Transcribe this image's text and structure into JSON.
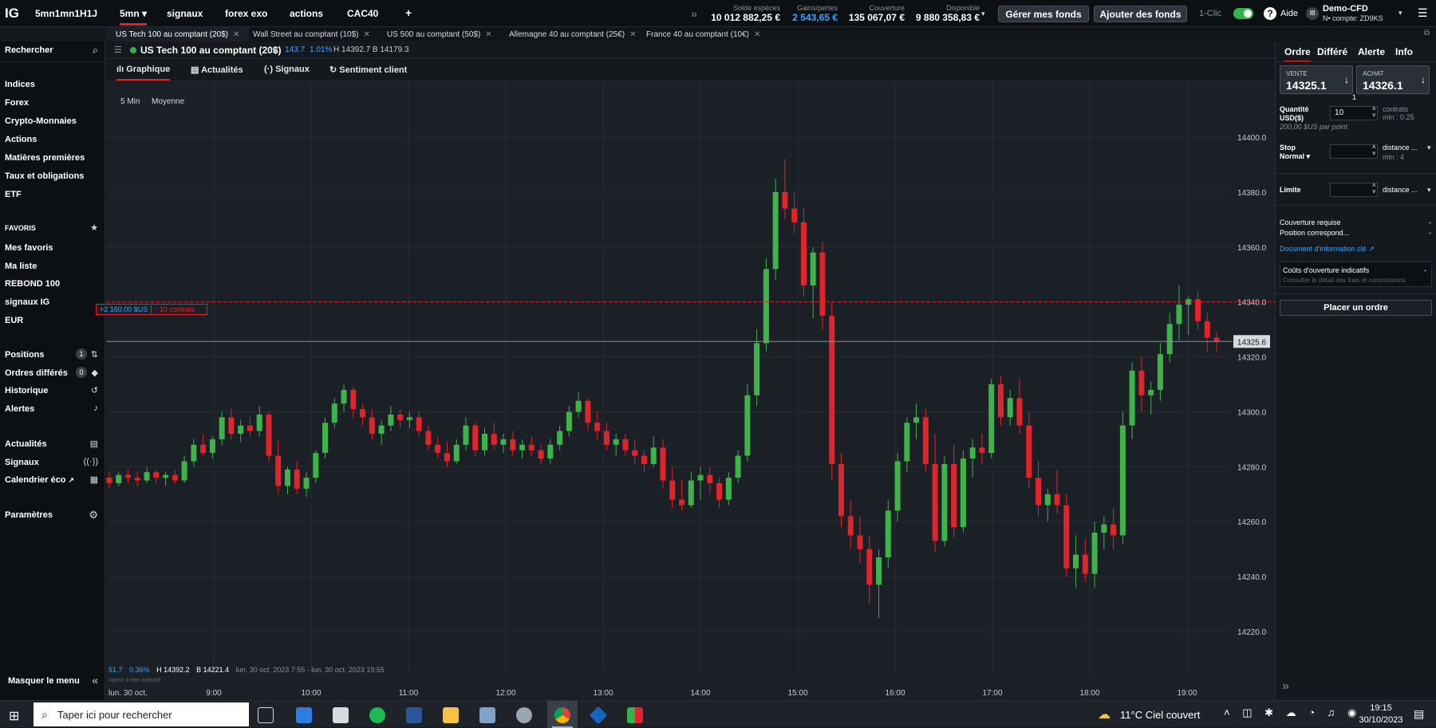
{
  "topbar": {
    "logo": "IG",
    "nav": [
      "5mn1mn1H1J",
      "5mn",
      "signaux",
      "forex exo",
      "actions",
      "CAC40",
      "+"
    ],
    "stats": [
      {
        "label": "Solde espèces",
        "value": "10 012 882,25 €"
      },
      {
        "label": "Gains/pertes",
        "value": "2 543,65 €"
      },
      {
        "label": "Couverture",
        "value": "135 067,07 €"
      },
      {
        "label": "Disponible",
        "value": "9 880 358,83 €"
      }
    ],
    "btn_manage": "Gérer mes fonds",
    "btn_add": "Ajouter des fonds",
    "oneclick": "1-Clic",
    "help": "Aide",
    "account_name": "Demo-CFD",
    "account_id": "N• compte: ZD9KS",
    "avatar": "IB",
    "accent": "#e0242b",
    "gain_color": "#3ba4ff"
  },
  "market_tabs": [
    "US Tech 100 au comptant (20$)",
    "Wall Street au comptant (10$)",
    "US 500 au comptant (50$)",
    "Allemagne 40 au comptant (25€)",
    "France 40 au comptant (10€)"
  ],
  "sidebar": {
    "search": "Rechercher",
    "markets": [
      "Indices",
      "Forex",
      "Crypto-Monnaies",
      "Actions",
      "Matières premières",
      "Taux et obligations",
      "ETF"
    ],
    "favorites_header": "FAVORIS",
    "favorites": [
      "Mes favoris",
      "Ma liste",
      "REBOND 100",
      "signaux IG",
      "EUR"
    ],
    "positions": "Positions",
    "positions_count": "1",
    "orders": "Ordres différés",
    "orders_count": "0",
    "history": "Historique",
    "alerts": "Alertes",
    "news": "Actualités",
    "signals": "Signaux",
    "calendar": "Calendrier éco",
    "settings": "Paramètres",
    "hide_menu": "Masquer le menu"
  },
  "chart_header": {
    "instrument": "US Tech 100 au comptant (20$)",
    "change": "143.7",
    "change_pct": "1.01%",
    "high_low": "H 14392.7  B 14179.3",
    "tabs": [
      "Graphique",
      "Actualités",
      "Signaux",
      "Sentiment client"
    ]
  },
  "chart_controls": {
    "interval": "5 Min",
    "type": "Moyenne"
  },
  "chart_footer": {
    "change": "51.7",
    "change_pct": "0.36%",
    "hl": "H 14392.2",
    "low": "B 14221.4",
    "range": "lun. 30 oct. 2023 7:55 - lun. 30 oct. 2023 19:55",
    "disclaimer": "Valeur à titre indicatif",
    "date_label": "lun. 30 oct."
  },
  "position_marker": {
    "pnl": "+2 160,00 $US",
    "size": "- 10 contrats",
    "price": 14340
  },
  "chart_data": {
    "type": "candlestick",
    "ylim": [
      14210,
      14410
    ],
    "yticks": [
      14220.0,
      14240.0,
      14260.0,
      14280.0,
      14300.0,
      14320.0,
      14340.0,
      14360.0,
      14380.0,
      14400.0
    ],
    "xticks": [
      "9:00",
      "10:00",
      "11:00",
      "12:00",
      "13:00",
      "14:00",
      "15:00",
      "16:00",
      "17:00",
      "18:00",
      "19:00"
    ],
    "last_price": 14325.6,
    "candles": [
      [
        14276,
        14278,
        14272,
        14274
      ],
      [
        14274,
        14278,
        14273,
        14277
      ],
      [
        14277,
        14279,
        14274,
        14276
      ],
      [
        14276,
        14278,
        14273,
        14275
      ],
      [
        14275,
        14280,
        14274,
        14278
      ],
      [
        14278,
        14279,
        14274,
        14276
      ],
      [
        14276,
        14278,
        14273,
        14277
      ],
      [
        14277,
        14279,
        14274,
        14275
      ],
      [
        14275,
        14284,
        14274,
        14282
      ],
      [
        14282,
        14290,
        14280,
        14288
      ],
      [
        14288,
        14292,
        14284,
        14285
      ],
      [
        14285,
        14291,
        14283,
        14290
      ],
      [
        14290,
        14300,
        14288,
        14298
      ],
      [
        14298,
        14301,
        14290,
        14292
      ],
      [
        14292,
        14297,
        14289,
        14295
      ],
      [
        14295,
        14298,
        14291,
        14293
      ],
      [
        14293,
        14302,
        14291,
        14299
      ],
      [
        14299,
        14300,
        14282,
        14284
      ],
      [
        14284,
        14290,
        14270,
        14273
      ],
      [
        14273,
        14280,
        14270,
        14279
      ],
      [
        14279,
        14282,
        14270,
        14272
      ],
      [
        14272,
        14278,
        14269,
        14276
      ],
      [
        14276,
        14286,
        14274,
        14285
      ],
      [
        14285,
        14298,
        14283,
        14296
      ],
      [
        14296,
        14305,
        14294,
        14303
      ],
      [
        14303,
        14310,
        14300,
        14308
      ],
      [
        14308,
        14309,
        14298,
        14301
      ],
      [
        14301,
        14303,
        14295,
        14298
      ],
      [
        14298,
        14301,
        14290,
        14292
      ],
      [
        14292,
        14297,
        14288,
        14295
      ],
      [
        14295,
        14302,
        14293,
        14299
      ],
      [
        14299,
        14301,
        14294,
        14297
      ],
      [
        14297,
        14300,
        14294,
        14298
      ],
      [
        14298,
        14300,
        14291,
        14293
      ],
      [
        14293,
        14295,
        14286,
        14288
      ],
      [
        14288,
        14291,
        14283,
        14285
      ],
      [
        14285,
        14289,
        14280,
        14282
      ],
      [
        14282,
        14290,
        14281,
        14288
      ],
      [
        14288,
        14298,
        14286,
        14295
      ],
      [
        14295,
        14296,
        14284,
        14286
      ],
      [
        14286,
        14294,
        14284,
        14292
      ],
      [
        14292,
        14296,
        14286,
        14288
      ],
      [
        14288,
        14292,
        14285,
        14290
      ],
      [
        14290,
        14293,
        14284,
        14286
      ],
      [
        14286,
        14290,
        14283,
        14288
      ],
      [
        14288,
        14291,
        14284,
        14286
      ],
      [
        14286,
        14288,
        14281,
        14283
      ],
      [
        14283,
        14290,
        14281,
        14288
      ],
      [
        14288,
        14295,
        14286,
        14293
      ],
      [
        14293,
        14302,
        14291,
        14300
      ],
      [
        14300,
        14307,
        14298,
        14304
      ],
      [
        14304,
        14305,
        14293,
        14296
      ],
      [
        14296,
        14300,
        14290,
        14293
      ],
      [
        14293,
        14296,
        14286,
        14288
      ],
      [
        14288,
        14292,
        14284,
        14290
      ],
      [
        14290,
        14292,
        14284,
        14286
      ],
      [
        14286,
        14290,
        14281,
        14284
      ],
      [
        14284,
        14286,
        14278,
        14281
      ],
      [
        14281,
        14291,
        14280,
        14287
      ],
      [
        14287,
        14290,
        14272,
        14275
      ],
      [
        14275,
        14280,
        14265,
        14268
      ],
      [
        14268,
        14275,
        14264,
        14266
      ],
      [
        14266,
        14278,
        14265,
        14275
      ],
      [
        14275,
        14280,
        14268,
        14277
      ],
      [
        14277,
        14280,
        14270,
        14274
      ],
      [
        14274,
        14276,
        14265,
        14268
      ],
      [
        14268,
        14278,
        14266,
        14276
      ],
      [
        14276,
        14286,
        14274,
        14284
      ],
      [
        14284,
        14310,
        14282,
        14306
      ],
      [
        14306,
        14330,
        14302,
        14325
      ],
      [
        14325,
        14356,
        14322,
        14352
      ],
      [
        14352,
        14385,
        14348,
        14380
      ],
      [
        14380,
        14392,
        14370,
        14374
      ],
      [
        14374,
        14380,
        14365,
        14369
      ],
      [
        14369,
        14374,
        14342,
        14346
      ],
      [
        14346,
        14360,
        14334,
        14358
      ],
      [
        14358,
        14362,
        14330,
        14335
      ],
      [
        14335,
        14340,
        14275,
        14281
      ],
      [
        14281,
        14285,
        14258,
        14262
      ],
      [
        14262,
        14268,
        14250,
        14255
      ],
      [
        14255,
        14262,
        14245,
        14250
      ],
      [
        14250,
        14255,
        14230,
        14237
      ],
      [
        14237,
        14250,
        14225,
        14247
      ],
      [
        14247,
        14268,
        14243,
        14264
      ],
      [
        14264,
        14285,
        14260,
        14282
      ],
      [
        14282,
        14298,
        14278,
        14296
      ],
      [
        14296,
        14303,
        14290,
        14298
      ],
      [
        14298,
        14301,
        14278,
        14281
      ],
      [
        14281,
        14292,
        14249,
        14253
      ],
      [
        14253,
        14284,
        14251,
        14281
      ],
      [
        14281,
        14288,
        14254,
        14258
      ],
      [
        14258,
        14286,
        14256,
        14283
      ],
      [
        14283,
        14290,
        14276,
        14287
      ],
      [
        14287,
        14292,
        14281,
        14285
      ],
      [
        14285,
        14312,
        14283,
        14310
      ],
      [
        14310,
        14313,
        14295,
        14298
      ],
      [
        14298,
        14308,
        14295,
        14305
      ],
      [
        14305,
        14312,
        14292,
        14295
      ],
      [
        14295,
        14300,
        14272,
        14276
      ],
      [
        14276,
        14282,
        14262,
        14266
      ],
      [
        14266,
        14272,
        14260,
        14270
      ],
      [
        14270,
        14279,
        14263,
        14266
      ],
      [
        14266,
        14270,
        14240,
        14243
      ],
      [
        14243,
        14255,
        14236,
        14248
      ],
      [
        14248,
        14254,
        14238,
        14241
      ],
      [
        14241,
        14260,
        14236,
        14256
      ],
      [
        14256,
        14262,
        14250,
        14259
      ],
      [
        14259,
        14265,
        14250,
        14255
      ],
      [
        14255,
        14300,
        14252,
        14295
      ],
      [
        14295,
        14318,
        14290,
        14315
      ],
      [
        14315,
        14320,
        14300,
        14306
      ],
      [
        14306,
        14311,
        14299,
        14308
      ],
      [
        14308,
        14325,
        14304,
        14321
      ],
      [
        14321,
        14336,
        14318,
        14332
      ],
      [
        14332,
        14346,
        14326,
        14339
      ],
      [
        14339,
        14342,
        14328,
        14341
      ],
      [
        14341,
        14344,
        14330,
        14333
      ],
      [
        14333,
        14336,
        14322,
        14327
      ],
      [
        14327,
        14329,
        14322,
        14325.6
      ]
    ]
  },
  "panel": {
    "tabs": [
      "Ordre",
      "Différé",
      "Alerte",
      "Info"
    ],
    "sell_label": "VENTE",
    "sell_price": "14325.1",
    "buy_label": "ACHAT",
    "buy_price": "14326.1",
    "spread": "1",
    "qty_label": "Quantité",
    "qty_unit": "USD($)",
    "qty_value": "10",
    "qty_unit2": "contrats",
    "qty_min": "min : 0.25",
    "per_point": "200,00 $US par point",
    "stop_label": "Stop",
    "stop_type": "Normal",
    "stop_distance": "distance ...",
    "stop_min": "min : 4",
    "limit_label": "Limite",
    "limit_distance": "distance ...",
    "margin_label": "Couverture requise",
    "margin_value": "-",
    "position_label": "Position correspond...",
    "position_value": "-",
    "doc_link": "Document d'information clé",
    "costs_title": "Coûts d'ouverture indicatifs",
    "costs_value": "-",
    "costs_sub": "Consulter le détail des frais et commissions",
    "place_order": "Placer un ordre"
  },
  "taskbar": {
    "search": "Taper ici pour rechercher",
    "weather": "11°C  Ciel couvert",
    "time": "19:15",
    "date": "30/10/2023"
  }
}
